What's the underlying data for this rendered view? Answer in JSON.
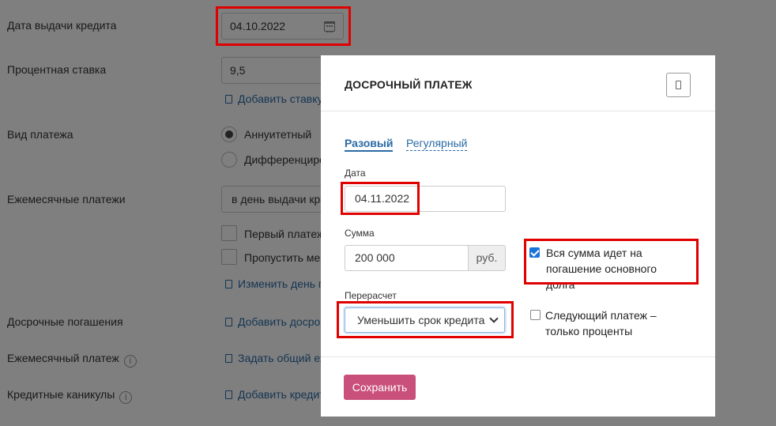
{
  "background": {
    "rows": [
      {
        "label": "Дата выдачи кредита"
      },
      {
        "label": "Процентная ставка"
      },
      {
        "label": "Вид платежа"
      },
      {
        "label": "Ежемесячные платежи"
      },
      {
        "label": "Досрочные погашения"
      },
      {
        "label": "Ежемесячный платеж"
      },
      {
        "label": "Кредитные каникулы"
      }
    ],
    "issue_date_value": "04.10.2022",
    "interest_rate_value": "9,5",
    "add_rate_link": "Добавить ставку",
    "payment_type_annuity": "Аннуитетный",
    "payment_type_diff": "Дифференциро",
    "monthly_payments_value": "в день выдачи кре",
    "first_payment_option": "Первый платеж",
    "skip_option": "Пропустить ме",
    "change_day_link": "Изменить день п",
    "add_prepayment_link": "Добавить досро",
    "set_total_link": "Задать общий ех",
    "add_holiday_link": "Добавить кредит",
    "info_glyph": "i"
  },
  "modal": {
    "title": "ДОСРОЧНЫЙ ПЛАТЕЖ",
    "tabs": [
      {
        "label": "Разовый",
        "active": true
      },
      {
        "label": "Регулярный",
        "active": false
      }
    ],
    "date_label": "Дата",
    "date_value": "04.11.2022",
    "amount_label": "Сумма",
    "amount_value": "200 000",
    "amount_unit": "руб.",
    "recalc_label": "Перерасчет",
    "recalc_selected": "Уменьшить срок кредита",
    "checkbox_principal": {
      "label": "Вся сумма идет на погашение основного долга",
      "checked": true
    },
    "checkbox_interest_only": {
      "label": "Следующий платеж – только проценты",
      "checked": false
    },
    "save_label": "Сохранить"
  },
  "colors": {
    "accent": "#2a6aa6",
    "save_button": "#c9507a",
    "highlight": "#e00000",
    "checkbox": "#1a73d9"
  }
}
